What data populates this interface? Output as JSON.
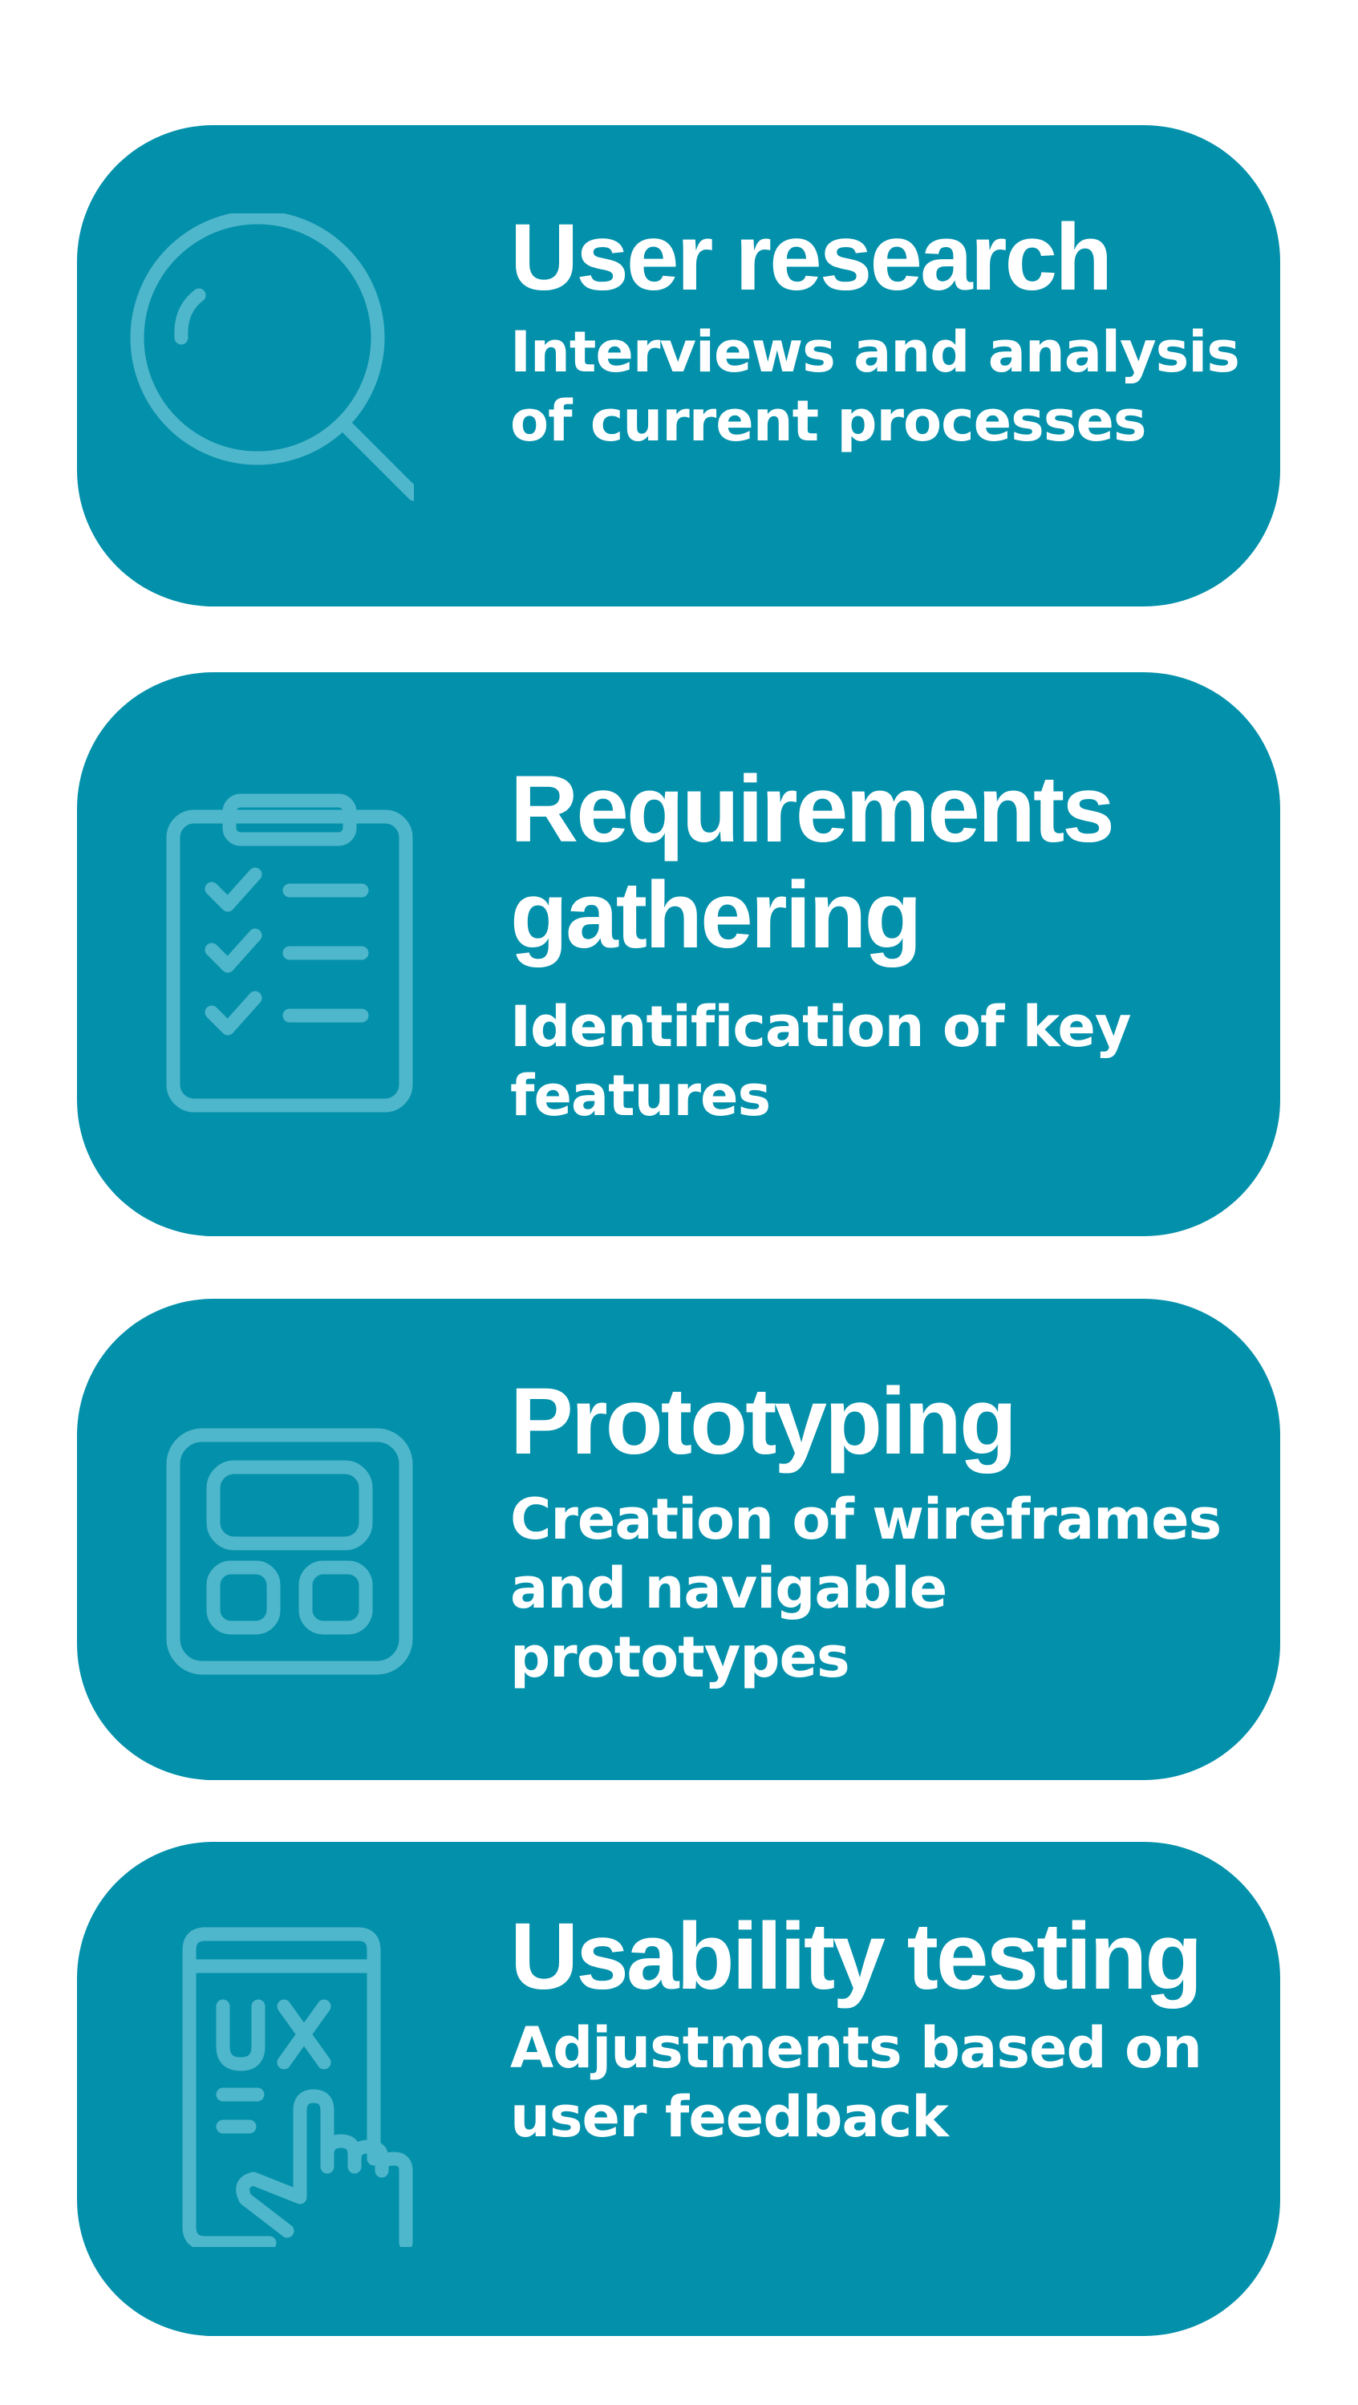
{
  "cards": [
    {
      "title": "User research",
      "description": "Interviews and analysis of current processes",
      "icon": "magnifying-glass-icon"
    },
    {
      "title": "Requirements gathering",
      "description": "Identification of key features",
      "icon": "clipboard-checklist-icon"
    },
    {
      "title": "Prototyping",
      "description": "Creation of wireframes and navigable prototypes",
      "icon": "wireframe-layout-icon"
    },
    {
      "title": "Usability testing",
      "description": "Adjustments based on user feedback",
      "icon": "ux-touch-screen-icon"
    }
  ],
  "colors": {
    "card_background": "#0390ab",
    "icon_stroke": "#4fb7cb",
    "text": "#ffffff",
    "page_background": "#ffffff"
  }
}
